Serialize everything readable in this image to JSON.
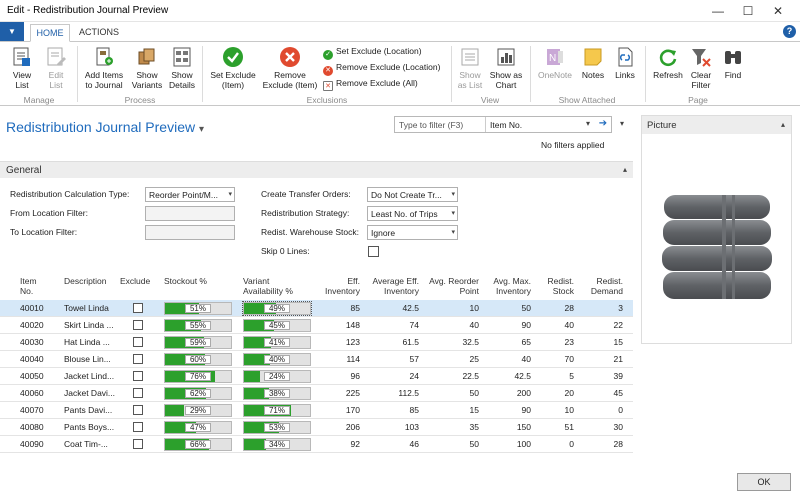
{
  "window": {
    "title": "Edit - Redistribution Journal Preview",
    "minimize": "—",
    "maximize": "☐",
    "close": "✕"
  },
  "tabs": {
    "app_menu": "▼",
    "home": "HOME",
    "actions": "ACTIONS",
    "help": "?"
  },
  "ribbon": {
    "manage": {
      "label": "Manage",
      "view_list": "View\nList",
      "edit_list": "Edit\nList"
    },
    "process": {
      "label": "Process",
      "add_items": "Add Items\nto Journal",
      "show_variants": "Show\nVariants",
      "show_details": "Show\nDetails"
    },
    "exclusions": {
      "label": "Exclusions",
      "set_exclude_item": "Set Exclude\n(Item)",
      "remove_exclude_item": "Remove\nExclude (Item)",
      "set_exclude_location": "Set Exclude (Location)",
      "remove_exclude_location": "Remove Exclude (Location)",
      "remove_exclude_all": "Remove Exclude (All)"
    },
    "view": {
      "label": "View",
      "show_as_list": "Show\nas List",
      "show_as_chart": "Show as\nChart"
    },
    "show_attached": {
      "label": "Show Attached",
      "onenote": "OneNote",
      "notes": "Notes",
      "links": "Links"
    },
    "page": {
      "label": "Page",
      "refresh": "Refresh",
      "clear_filter": "Clear\nFilter",
      "find": "Find"
    }
  },
  "page": {
    "title": "Redistribution Journal Preview",
    "title_arrow": "▾",
    "filter_placeholder": "Type to filter (F3)",
    "filter_field": "Item No.",
    "filter_dd": "▾",
    "filter_go": "➔",
    "no_filters": "No filters applied",
    "collapse": "▾",
    "ok": "OK"
  },
  "general": {
    "header": "General",
    "collapse": "▴",
    "calc_type_label": "Redistribution Calculation Type:",
    "calc_type_value": "Reorder Point/M...",
    "from_location_label": "From Location Filter:",
    "from_location_value": "",
    "to_location_label": "To Location Filter:",
    "to_location_value": "",
    "create_transfer_label": "Create Transfer Orders:",
    "create_transfer_value": "Do Not Create Tr...",
    "strategy_label": "Redistribution Strategy:",
    "strategy_value": "Least No. of Trips",
    "warehouse_label": "Redist. Warehouse Stock:",
    "warehouse_value": "Ignore",
    "skip_zero_label": "Skip 0 Lines:",
    "dd": "▾"
  },
  "grid": {
    "headers": {
      "item_no": "Item\nNo.",
      "description": "Description",
      "exclude": "Exclude",
      "stockout": "Stockout %",
      "variant_avail": "Variant\nAvailability %",
      "eff_inventory": "Eff.\nInventory",
      "avg_eff_inventory": "Average Eff.\nInventory",
      "avg_reorder": "Avg. Reorder\nPoint",
      "avg_max": "Avg. Max.\nInventory",
      "redist_stock": "Redist.\nStock",
      "redist_demand": "Redist.\nDemand"
    },
    "rows": [
      {
        "item_no": "40010",
        "description": "Towel Linda",
        "stockout": 51,
        "stockout_label": "51%",
        "variant": 49,
        "variant_label": "49%",
        "eff_inventory": "85",
        "avg_eff_inventory": "42.5",
        "avg_reorder": "10",
        "avg_max": "50",
        "redist_stock": "28",
        "redist_demand": "3"
      },
      {
        "item_no": "40020",
        "description": "Skirt Linda ...",
        "stockout": 55,
        "stockout_label": "55%",
        "variant": 45,
        "variant_label": "45%",
        "eff_inventory": "148",
        "avg_eff_inventory": "74",
        "avg_reorder": "40",
        "avg_max": "90",
        "redist_stock": "40",
        "redist_demand": "22"
      },
      {
        "item_no": "40030",
        "description": "Hat Linda ...",
        "stockout": 59,
        "stockout_label": "59%",
        "variant": 41,
        "variant_label": "41%",
        "eff_inventory": "123",
        "avg_eff_inventory": "61.5",
        "avg_reorder": "32.5",
        "avg_max": "65",
        "redist_stock": "23",
        "redist_demand": "15"
      },
      {
        "item_no": "40040",
        "description": "Blouse Lin...",
        "stockout": 60,
        "stockout_label": "60%",
        "variant": 40,
        "variant_label": "40%",
        "eff_inventory": "114",
        "avg_eff_inventory": "57",
        "avg_reorder": "25",
        "avg_max": "40",
        "redist_stock": "70",
        "redist_demand": "21"
      },
      {
        "item_no": "40050",
        "description": "Jacket Lind...",
        "stockout": 76,
        "stockout_label": "76%",
        "variant": 24,
        "variant_label": "24%",
        "eff_inventory": "96",
        "avg_eff_inventory": "24",
        "avg_reorder": "22.5",
        "avg_max": "42.5",
        "redist_stock": "5",
        "redist_demand": "39"
      },
      {
        "item_no": "40060",
        "description": "Jacket Davi...",
        "stockout": 62,
        "stockout_label": "62%",
        "variant": 38,
        "variant_label": "38%",
        "eff_inventory": "225",
        "avg_eff_inventory": "112.5",
        "avg_reorder": "50",
        "avg_max": "200",
        "redist_stock": "20",
        "redist_demand": "45"
      },
      {
        "item_no": "40070",
        "description": "Pants Davi...",
        "stockout": 29,
        "stockout_label": "29%",
        "variant": 71,
        "variant_label": "71%",
        "eff_inventory": "170",
        "avg_eff_inventory": "85",
        "avg_reorder": "15",
        "avg_max": "90",
        "redist_stock": "10",
        "redist_demand": "0"
      },
      {
        "item_no": "40080",
        "description": "Pants Boys...",
        "stockout": 47,
        "stockout_label": "47%",
        "variant": 53,
        "variant_label": "53%",
        "eff_inventory": "206",
        "avg_eff_inventory": "103",
        "avg_reorder": "35",
        "avg_max": "150",
        "redist_stock": "51",
        "redist_demand": "30"
      },
      {
        "item_no": "40090",
        "description": "Coat Tim-...",
        "stockout": 66,
        "stockout_label": "66%",
        "variant": 34,
        "variant_label": "34%",
        "eff_inventory": "92",
        "avg_eff_inventory": "46",
        "avg_reorder": "50",
        "avg_max": "100",
        "redist_stock": "0",
        "redist_demand": "28"
      }
    ]
  },
  "picture_pane": {
    "header": "Picture",
    "collapse": "▴",
    "image_icon": "towel-stack-image"
  },
  "colors": {
    "accent": "#1f6bbd",
    "bar_fill": "#2ca02c",
    "selected_row": "#d6e8f8"
  }
}
